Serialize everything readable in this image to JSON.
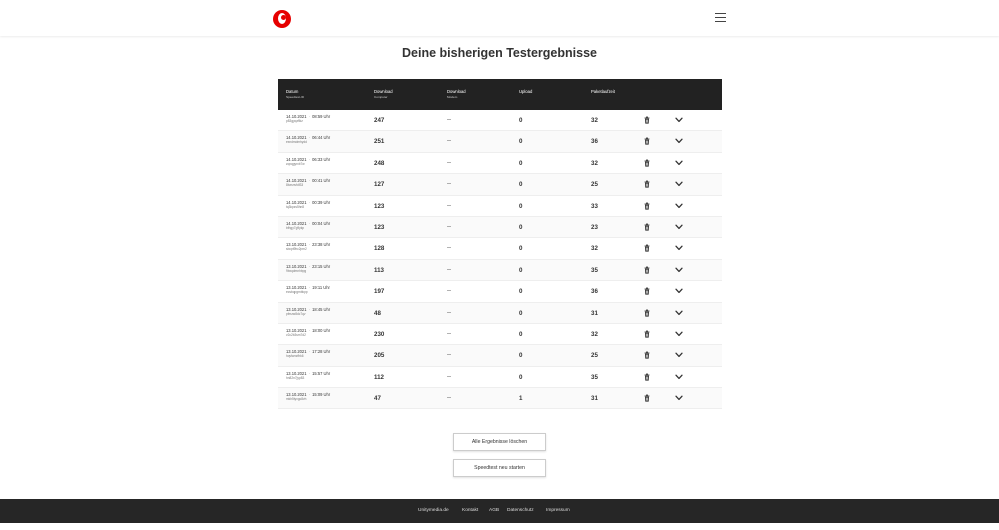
{
  "page": {
    "title": "Deine bisherigen Testergebnisse"
  },
  "colors": {
    "brand": "#e60000",
    "header_bg": "#222222",
    "footer_bg": "#262626"
  },
  "table": {
    "headers": {
      "date": "Datum",
      "date_sub": "Speedtest-ID",
      "download": "Download",
      "download_sub": "Computer",
      "download_modem": "Download",
      "download_modem_sub": "Modem",
      "upload": "Upload",
      "ping": "Paketlaufzeit"
    },
    "rows": [
      {
        "date": "14.10.2021",
        "sep": "·",
        "time": "08:59 Uhr",
        "id": "p83gyqzflkz",
        "download": "247",
        "modem": "--",
        "upload": "0",
        "ping": "32"
      },
      {
        "date": "14.10.2021",
        "sep": "·",
        "time": "06:44 Uhr",
        "id": "exndmdmhydd",
        "download": "251",
        "modem": "--",
        "upload": "0",
        "ping": "36"
      },
      {
        "date": "14.10.2021",
        "sep": "·",
        "time": "06:33 Uhr",
        "id": "zqxqgyrxb7w",
        "download": "248",
        "modem": "--",
        "upload": "0",
        "ping": "32"
      },
      {
        "date": "14.10.2021",
        "sep": "·",
        "time": "00:41 Uhr",
        "id": "8bzsnvfdf33",
        "download": "127",
        "modem": "--",
        "upload": "0",
        "ping": "25"
      },
      {
        "date": "14.10.2021",
        "sep": "·",
        "time": "00:39 Uhr",
        "id": "tq3kpzs5hn8",
        "download": "123",
        "modem": "--",
        "upload": "0",
        "ping": "33"
      },
      {
        "date": "14.10.2021",
        "sep": "·",
        "time": "00:04 Uhr",
        "id": "bfhgy7g9ykp",
        "download": "123",
        "modem": "--",
        "upload": "0",
        "ping": "23"
      },
      {
        "date": "13.10.2021",
        "sep": "·",
        "time": "23:38 Uhr",
        "id": "sbcpt9hc2pm2",
        "download": "128",
        "modem": "--",
        "upload": "0",
        "ping": "32"
      },
      {
        "date": "13.10.2021",
        "sep": "·",
        "time": "23:15 Uhr",
        "id": "9bxqdmnhbpg",
        "download": "113",
        "modem": "--",
        "upload": "0",
        "ping": "35"
      },
      {
        "date": "13.10.2021",
        "sep": "·",
        "time": "19:11 Uhr",
        "id": "ecsbqpgmbkpp",
        "download": "197",
        "modem": "--",
        "upload": "0",
        "ping": "36"
      },
      {
        "date": "13.10.2021",
        "sep": "·",
        "time": "18:45 Uhr",
        "id": "pfmzw8dc7qv",
        "download": "48",
        "modem": "--",
        "upload": "0",
        "ping": "31"
      },
      {
        "date": "13.10.2021",
        "sep": "·",
        "time": "18:00 Uhr",
        "id": "v2c2b3sm7d2",
        "download": "230",
        "modem": "--",
        "upload": "0",
        "ping": "32"
      },
      {
        "date": "13.10.2021",
        "sep": "·",
        "time": "17:28 Uhr",
        "id": "hqvfwxzfhk6",
        "download": "205",
        "modem": "--",
        "upload": "0",
        "ping": "25"
      },
      {
        "date": "13.10.2021",
        "sep": "·",
        "time": "15:57 Uhr",
        "id": "hn82n7jyp83",
        "download": "112",
        "modem": "--",
        "upload": "0",
        "ping": "35"
      },
      {
        "date": "13.10.2021",
        "sep": "·",
        "time": "15:09 Uhr",
        "id": "mkh5tyxgc8vh",
        "download": "47",
        "modem": "--",
        "upload": "1",
        "ping": "31"
      }
    ]
  },
  "actions": {
    "delete_all": "Alle Ergebnisse löschen",
    "restart": "Speedtest neu starten"
  },
  "footer": {
    "links": [
      "Unitymedia.de",
      "Kontakt",
      "AGB",
      "Datenschutz",
      "Impressum"
    ]
  },
  "icons": {
    "logo": "vodafone-logo",
    "menu": "hamburger-menu-icon",
    "row_delete": "trash-icon",
    "row_expand": "chevron-down-icon"
  }
}
